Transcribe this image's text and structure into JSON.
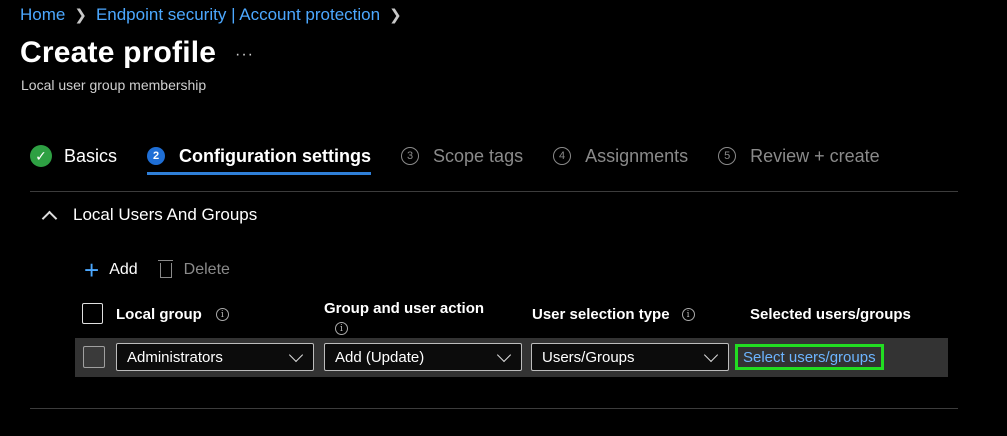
{
  "breadcrumb": {
    "home": "Home",
    "section": "Endpoint security | Account protection"
  },
  "page": {
    "title": "Create profile",
    "more": "···",
    "subtitle": "Local user group membership"
  },
  "steps": [
    {
      "number": "✓",
      "label": "Basics",
      "state": "done"
    },
    {
      "number": "2",
      "label": "Configuration settings",
      "state": "active"
    },
    {
      "number": "3",
      "label": "Scope tags",
      "state": "pending"
    },
    {
      "number": "4",
      "label": "Assignments",
      "state": "pending"
    },
    {
      "number": "5",
      "label": "Review + create",
      "state": "pending"
    }
  ],
  "section": {
    "title": "Local Users And Groups"
  },
  "toolbar": {
    "add_label": "Add",
    "delete_label": "Delete"
  },
  "table": {
    "headers": {
      "local_group": "Local group",
      "action": "Group and user action",
      "selection_type": "User selection type",
      "selected": "Selected users/groups"
    },
    "rows": [
      {
        "local_group": "Administrators",
        "action": "Add (Update)",
        "selection_type": "Users/Groups",
        "selected_link": "Select users/groups"
      }
    ]
  },
  "icons": {
    "info": "info-icon",
    "add": "plus-icon",
    "delete": "trash-icon"
  },
  "colors": {
    "accent": "#4ca8ff",
    "success": "#2ea043",
    "highlight": "#22dd22"
  }
}
